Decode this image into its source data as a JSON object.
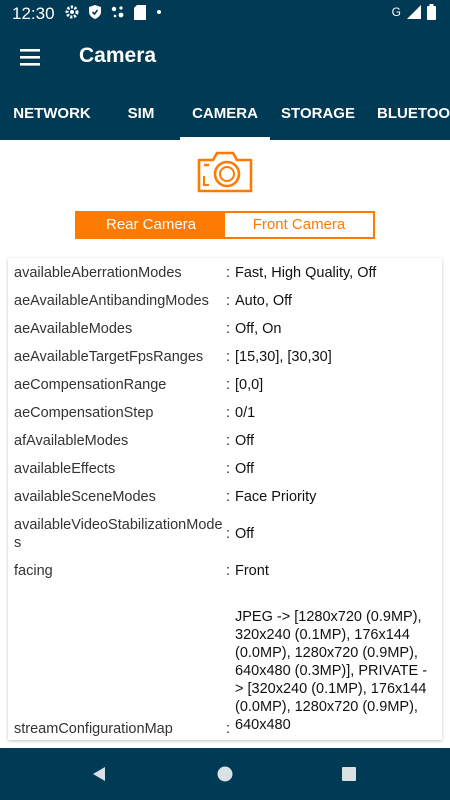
{
  "status_bar": {
    "time": "12:30",
    "network_letter": "G"
  },
  "app_bar": {
    "title": "Camera",
    "menu_icon": "hamburger-menu-icon"
  },
  "tabs": [
    {
      "label": "NETWORK",
      "active": false
    },
    {
      "label": "SIM",
      "active": false
    },
    {
      "label": "CAMERA",
      "active": true
    },
    {
      "label": "STORAGE",
      "active": false
    },
    {
      "label": "BLUETOOTH",
      "active": false
    }
  ],
  "camera_toggle": {
    "rear_label": "Rear Camera",
    "front_label": "Front Camera",
    "selected": "rear"
  },
  "properties": [
    {
      "key": "availableAberrationModes",
      "value": "Fast, High Quality, Off"
    },
    {
      "key": "aeAvailableAntibandingModes",
      "value": "Auto, Off"
    },
    {
      "key": "aeAvailableModes",
      "value": "Off, On"
    },
    {
      "key": "aeAvailableTargetFpsRanges",
      "value": "[15,30], [30,30]"
    },
    {
      "key": "aeCompensationRange",
      "value": "[0,0]"
    },
    {
      "key": "aeCompensationStep",
      "value": "0/1"
    },
    {
      "key": "afAvailableModes",
      "value": "Off"
    },
    {
      "key": "availableEffects",
      "value": "Off"
    },
    {
      "key": "availableSceneModes",
      "value": "Face Priority"
    },
    {
      "key": "availableVideoStabilizationModes",
      "value": "Off"
    },
    {
      "key": "facing",
      "value": "Front"
    },
    {
      "key": "streamConfigurationMap",
      "value": "JPEG -> [1280x720 (0.9MP), 320x240 (0.1MP), 176x144 (0.0MP), 1280x720 (0.9MP), 640x480 (0.3MP)], PRIVATE -> [320x240 (0.1MP), 176x144 (0.0MP), 1280x720 (0.9MP), 640x480"
    }
  ],
  "colors": {
    "primary_dark": "#003a55",
    "accent": "#ff7a00"
  },
  "nav_bar": {
    "icons": [
      "back-icon",
      "home-icon",
      "recents-icon"
    ]
  }
}
